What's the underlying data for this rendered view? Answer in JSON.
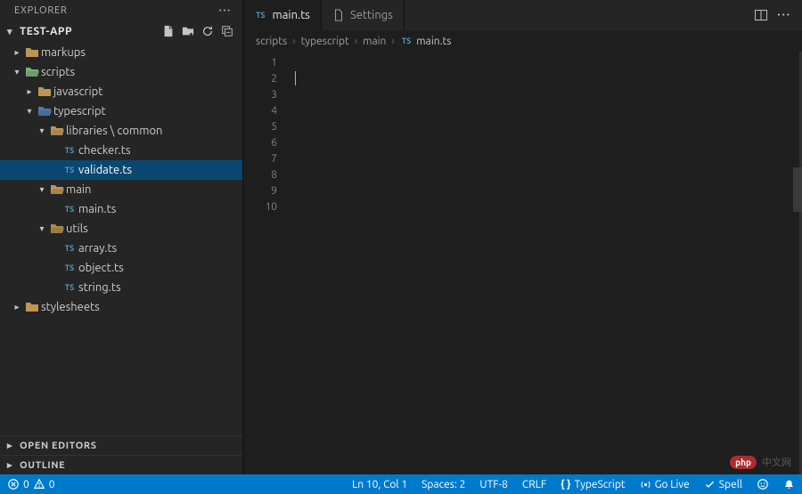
{
  "explorer": {
    "title": "EXPLORER",
    "project": "TEST-APP",
    "actions": {
      "new_file": "new-file",
      "new_folder": "new-folder",
      "refresh": "refresh",
      "collapse": "collapse-all"
    },
    "tree": [
      {
        "kind": "folder",
        "label": "markups",
        "depth": 0,
        "expanded": false,
        "icon": "folder"
      },
      {
        "kind": "folder",
        "label": "scripts",
        "depth": 0,
        "expanded": true,
        "icon": "folder-src"
      },
      {
        "kind": "folder",
        "label": "javascript",
        "depth": 1,
        "expanded": false,
        "icon": "folder"
      },
      {
        "kind": "folder",
        "label": "typescript",
        "depth": 1,
        "expanded": true,
        "icon": "folder-ts"
      },
      {
        "kind": "folder",
        "label": "libraries \\ common",
        "depth": 2,
        "expanded": true,
        "icon": "folder"
      },
      {
        "kind": "file",
        "label": "checker.ts",
        "depth": 3,
        "icon": "ts"
      },
      {
        "kind": "file",
        "label": "validate.ts",
        "depth": 3,
        "icon": "ts",
        "selected": true
      },
      {
        "kind": "folder",
        "label": "main",
        "depth": 2,
        "expanded": true,
        "icon": "folder"
      },
      {
        "kind": "file",
        "label": "main.ts",
        "depth": 3,
        "icon": "ts"
      },
      {
        "kind": "folder",
        "label": "utils",
        "depth": 2,
        "expanded": true,
        "icon": "folder-util"
      },
      {
        "kind": "file",
        "label": "array.ts",
        "depth": 3,
        "icon": "ts"
      },
      {
        "kind": "file",
        "label": "object.ts",
        "depth": 3,
        "icon": "ts"
      },
      {
        "kind": "file",
        "label": "string.ts",
        "depth": 3,
        "icon": "ts"
      },
      {
        "kind": "folder",
        "label": "stylesheets",
        "depth": 0,
        "expanded": false,
        "icon": "folder"
      }
    ],
    "sections": {
      "open_editors": "OPEN EDITORS",
      "outline": "OUTLINE"
    }
  },
  "tabs": [
    {
      "label": "main.ts",
      "icon": "ts",
      "active": true
    },
    {
      "label": "Settings",
      "icon": "file",
      "active": false
    }
  ],
  "breadcrumbs": {
    "parts": [
      "scripts",
      "typescript",
      "main"
    ],
    "file": {
      "icon": "ts",
      "label": "main.ts"
    }
  },
  "editor": {
    "line_count": 10
  },
  "status": {
    "errors": "0",
    "warnings": "0",
    "ln_col": "Ln 10, Col 1",
    "spaces": "Spaces: 2",
    "encoding": "UTF-8",
    "eol": "CRLF",
    "language": "TypeScript",
    "golive": "Go Live",
    "spell": "Spell",
    "feedback_icon": "feedback",
    "bell_icon": "notifications"
  },
  "watermark": {
    "badge": "php",
    "text": "中文网"
  }
}
